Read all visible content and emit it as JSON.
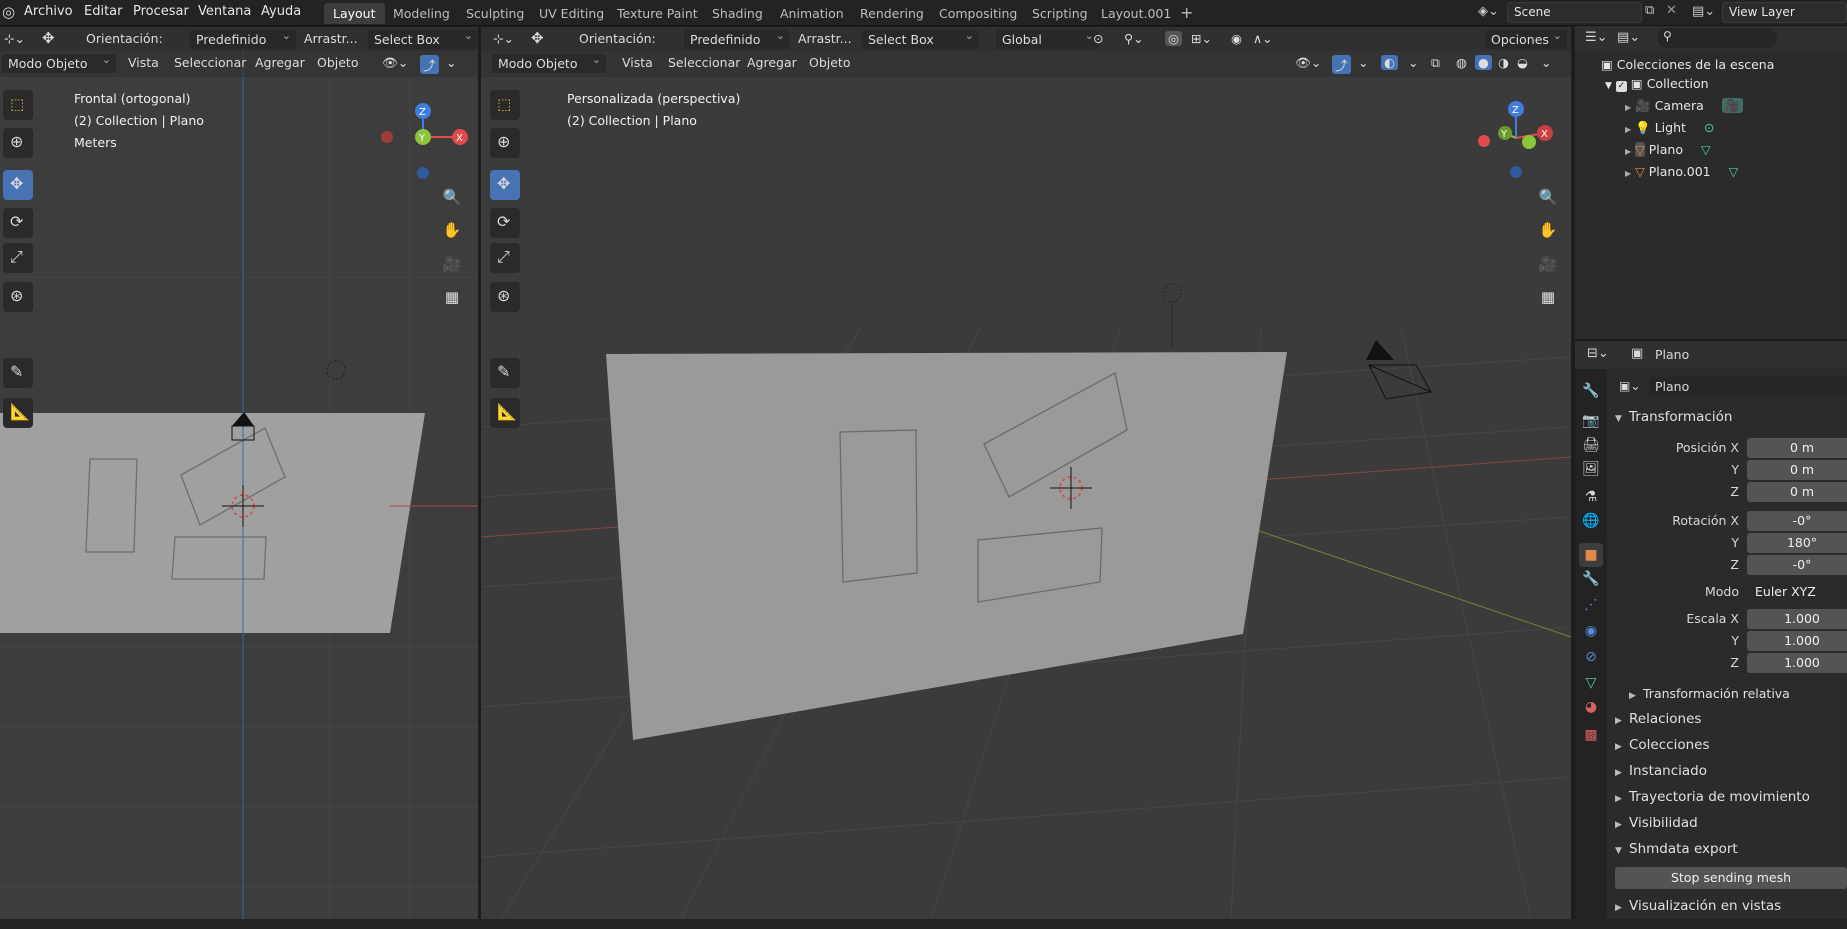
{
  "menubar": {
    "items": [
      "Archivo",
      "Editar",
      "Procesar",
      "Ventana",
      "Ayuda"
    ]
  },
  "workspaces": [
    "Layout",
    "Modeling",
    "Sculpting",
    "UV Editing",
    "Texture Paint",
    "Shading",
    "Animation",
    "Rendering",
    "Compositing",
    "Scripting",
    "Layout.001"
  ],
  "scene": {
    "name": "Scene",
    "view_layer": "View Layer"
  },
  "left_view": {
    "orientation_label": "Orientación:",
    "orientation_value": "Predefinido",
    "drag_label": "Arrastr...",
    "select_mode": "Select Box",
    "mode": "Modo Objeto",
    "menus": [
      "Vista",
      "Seleccionar",
      "Agregar",
      "Objeto"
    ],
    "view_name": "Frontal (ortogonal)",
    "collection_info": "(2) Collection | Plano",
    "units": "Meters"
  },
  "right_view": {
    "orientation_label": "Orientación:",
    "orientation_value": "Predefinido",
    "drag_label": "Arrastr...",
    "select_mode": "Select Box",
    "transform_space": "Global",
    "options": "Opciones",
    "mode": "Modo Objeto",
    "menus": [
      "Vista",
      "Seleccionar",
      "Agregar",
      "Objeto"
    ],
    "view_name": "Personalizada (perspectiva)",
    "collection_info": "(2) Collection | Plano"
  },
  "gizmo": {
    "z": "Z",
    "y": "Y",
    "x": "X"
  },
  "outliner": {
    "root": "Colecciones de la escena",
    "collection": "Collection",
    "objects": [
      "Camera",
      "Light",
      "Plano",
      "Plano.001"
    ]
  },
  "properties": {
    "object_name": "Plano",
    "datablock_name": "Plano",
    "transform_title": "Transformación",
    "position_label": "Posición X",
    "position": [
      "0 m",
      "0 m",
      "0 m"
    ],
    "rotation_label": "Rotación X",
    "rotation": [
      "-0°",
      "180°",
      "-0°"
    ],
    "axis_y": "Y",
    "axis_z": "Z",
    "mode_label": "Modo",
    "mode_value": "Euler XYZ",
    "scale_label": "Escala X",
    "scale": [
      "1.000",
      "1.000",
      "1.000"
    ],
    "delta": "Transformación relativa",
    "sections": [
      "Relaciones",
      "Colecciones",
      "Instanciado",
      "Trayectoria de movimiento",
      "Visibilidad"
    ],
    "shmdata": "Shmdata export",
    "stop_button": "Stop sending mesh",
    "viewport_display": "Visualización en vistas"
  }
}
